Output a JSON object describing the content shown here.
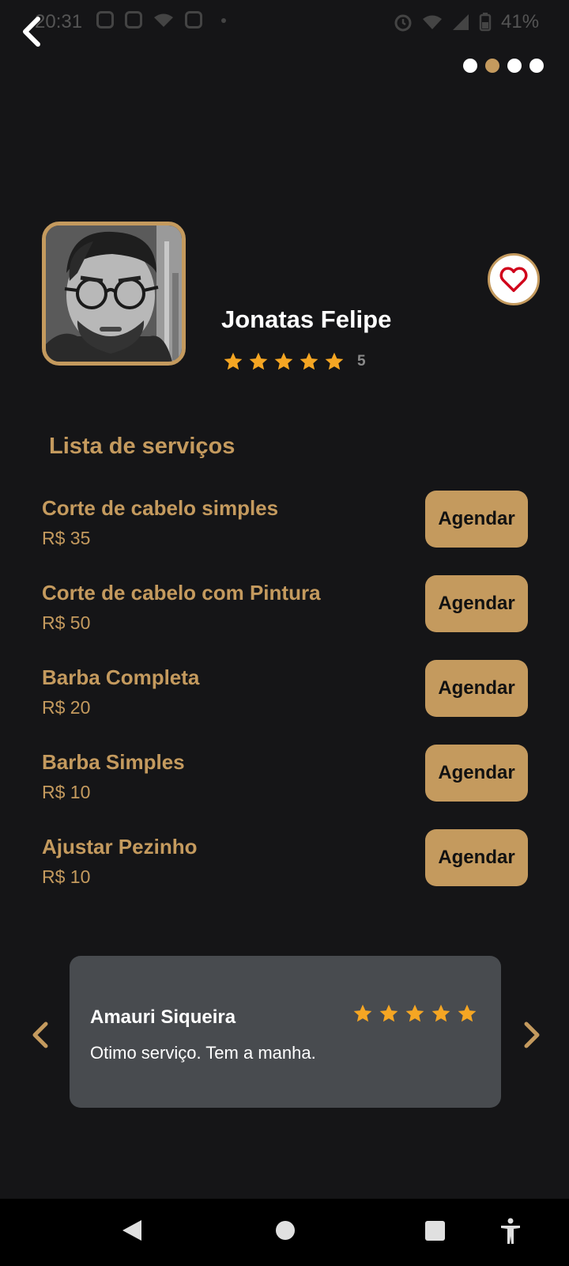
{
  "status_bar": {
    "time": "20:31",
    "battery": "41%"
  },
  "pager": {
    "total": 4,
    "active_index": 1
  },
  "barber": {
    "name": "Jonatas Felipe",
    "rating": 5,
    "rating_label": "5"
  },
  "services_section": {
    "title": "Lista de serviços",
    "items": [
      {
        "name": "Corte de cabelo simples",
        "price": "R$ 35",
        "button": "Agendar"
      },
      {
        "name": "Corte de cabelo com Pintura",
        "price": "R$ 50",
        "button": "Agendar"
      },
      {
        "name": "Barba Completa",
        "price": "R$ 20",
        "button": "Agendar"
      },
      {
        "name": "Barba Simples",
        "price": "R$ 10",
        "button": "Agendar"
      },
      {
        "name": "Ajustar Pezinho",
        "price": "R$ 10",
        "button": "Agendar"
      }
    ]
  },
  "review": {
    "author": "Amauri Siqueira",
    "text": "Otimo serviço. Tem a manha.",
    "stars": 5
  },
  "colors": {
    "background": "#151517",
    "accent": "#c49a5e",
    "star": "#f5a623",
    "card": "#484b4f",
    "heart": "#d0021b"
  },
  "icons": {
    "back": "chevron-left-icon",
    "favorite": "heart-icon",
    "star": "star-icon",
    "prev": "chevron-left-icon",
    "next": "chevron-right-icon",
    "nav_back": "triangle-back-icon",
    "nav_home": "circle-home-icon",
    "nav_recents": "square-recents-icon",
    "accessibility": "accessibility-icon"
  }
}
